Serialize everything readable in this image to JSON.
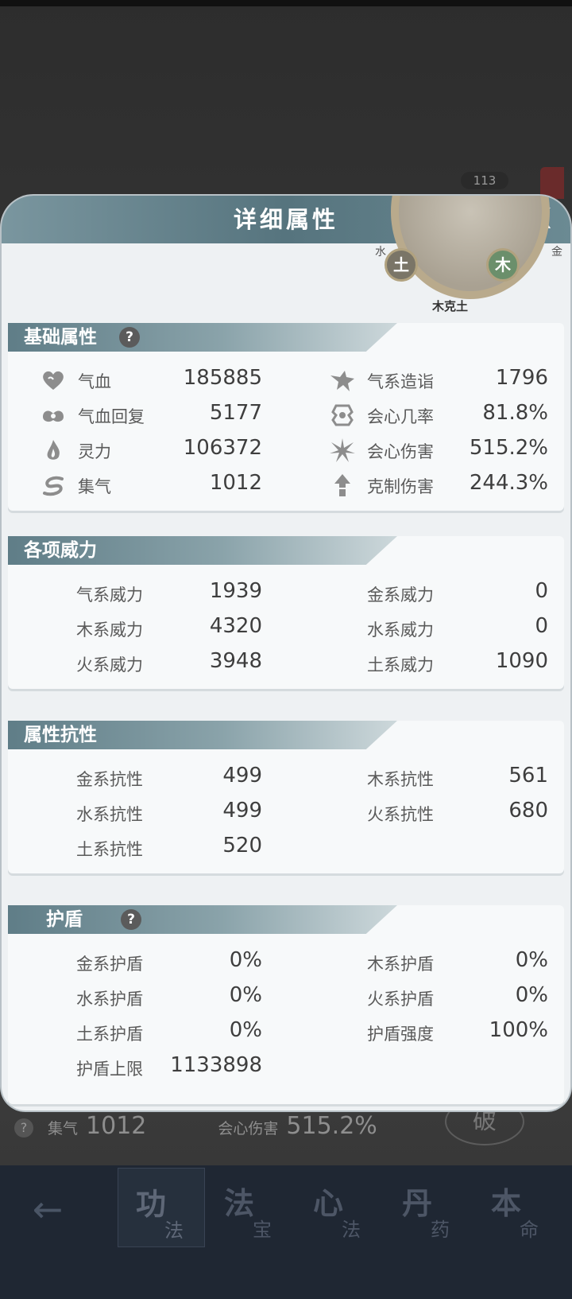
{
  "background": {
    "level_badge": "113",
    "stats_row": {
      "label1": "集气",
      "value1": "1012",
      "label2": "会心伤害",
      "value2": "515.2%"
    },
    "question": "?",
    "break_label": "破"
  },
  "bottom_nav": {
    "back_icon": "←",
    "tabs": [
      {
        "big": "功",
        "small": "法"
      },
      {
        "big": "法",
        "small": "宝"
      },
      {
        "big": "心",
        "small": "法"
      },
      {
        "big": "丹",
        "small": "药"
      },
      {
        "big": "本",
        "small": "命"
      }
    ]
  },
  "panel": {
    "title": "详细属性",
    "close": "X",
    "wheel": {
      "earth": "土",
      "wood": "木",
      "caption": "木克土",
      "left_side": "水",
      "right_side": "金"
    },
    "basic": {
      "title": "基础属性",
      "help": "?",
      "left": [
        {
          "label": "气血",
          "value": "185885",
          "icon": "heart-icon"
        },
        {
          "label": "气血回复",
          "value": "5177",
          "icon": "heal-icon"
        },
        {
          "label": "灵力",
          "value": "106372",
          "icon": "flame-icon"
        },
        {
          "label": "集气",
          "value": "1012",
          "icon": "swirl-icon"
        }
      ],
      "right": [
        {
          "label": "气系造诣",
          "value": "1796",
          "icon": "beast-icon"
        },
        {
          "label": "会心几率",
          "value": "81.8%",
          "icon": "crit-icon"
        },
        {
          "label": "会心伤害",
          "value": "515.2%",
          "icon": "burst-icon"
        },
        {
          "label": "克制伤害",
          "value": "244.3%",
          "icon": "arrow-up-icon"
        }
      ]
    },
    "power": {
      "title": "各项威力",
      "left": [
        {
          "label": "气系威力",
          "value": "1939"
        },
        {
          "label": "木系威力",
          "value": "4320"
        },
        {
          "label": "火系威力",
          "value": "3948"
        }
      ],
      "right": [
        {
          "label": "金系威力",
          "value": "0"
        },
        {
          "label": "水系威力",
          "value": "0"
        },
        {
          "label": "土系威力",
          "value": "1090"
        }
      ]
    },
    "resist": {
      "title": "属性抗性",
      "left": [
        {
          "label": "金系抗性",
          "value": "499"
        },
        {
          "label": "水系抗性",
          "value": "499"
        },
        {
          "label": "土系抗性",
          "value": "520"
        }
      ],
      "right": [
        {
          "label": "木系抗性",
          "value": "561"
        },
        {
          "label": "火系抗性",
          "value": "680"
        }
      ]
    },
    "shield": {
      "title": "护盾",
      "help": "?",
      "left": [
        {
          "label": "金系护盾",
          "value": "0%"
        },
        {
          "label": "水系护盾",
          "value": "0%"
        },
        {
          "label": "土系护盾",
          "value": "0%"
        },
        {
          "label": "护盾上限",
          "value": "1133898"
        }
      ],
      "right": [
        {
          "label": "木系护盾",
          "value": "0%"
        },
        {
          "label": "火系护盾",
          "value": "0%"
        },
        {
          "label": "护盾强度",
          "value": "100%"
        }
      ]
    }
  }
}
